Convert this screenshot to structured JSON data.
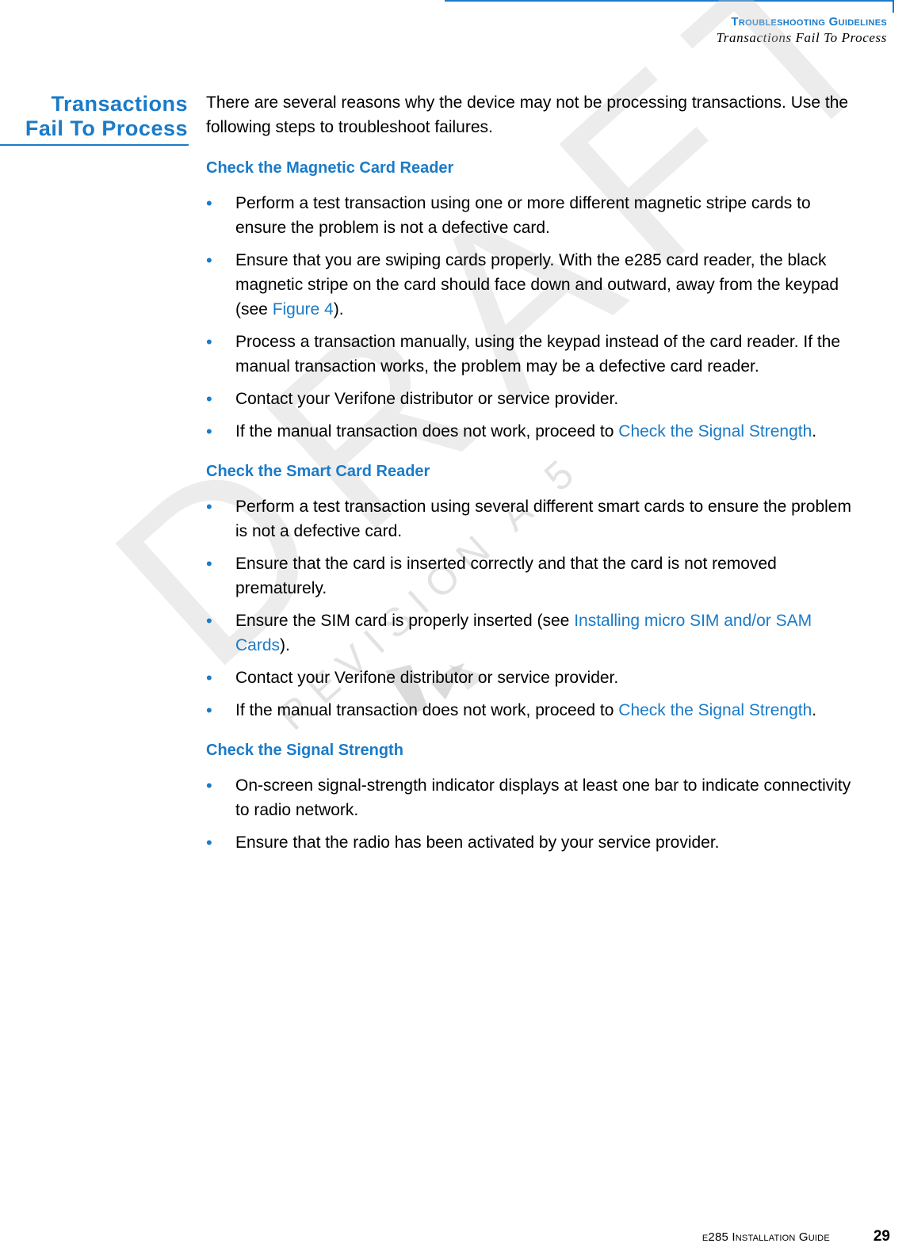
{
  "header": {
    "section": "Troubleshooting Guidelines",
    "topic": "Transactions Fail To Process"
  },
  "side_title": {
    "line1": "Transactions",
    "line2": "Fail To Process"
  },
  "intro": "There are several reasons why the device may not be processing transactions. Use the following steps to troubleshoot failures.",
  "sections": [
    {
      "heading": "Check the Magnetic Card Reader",
      "items": [
        {
          "text": "Perform a test transaction using one or more different magnetic stripe cards to ensure the problem is not a defective card."
        },
        {
          "text": "Ensure that you are swiping cards properly. With the e285 card reader, the black magnetic stripe on the card should face down and outward, away from the keypad (see ",
          "link": "Figure 4",
          "after": ")."
        },
        {
          "text": "Process a transaction manually, using the keypad instead of the card reader. If the manual transaction works, the problem may be a defective card reader."
        },
        {
          "text": "Contact your Verifone distributor or service provider."
        },
        {
          "text": "If the manual transaction does not work, proceed to ",
          "link": "Check the Signal Strength",
          "after": "."
        }
      ]
    },
    {
      "heading": "Check the Smart Card Reader",
      "items": [
        {
          "text": "Perform a test transaction using several different smart cards to ensure the problem is not a defective card."
        },
        {
          "text": "Ensure that the card is inserted correctly and that the card is not removed prematurely."
        },
        {
          "text": "Ensure the SIM card is properly inserted (see ",
          "link": "Installing micro SIM and/or SAM Cards",
          "after": ")."
        },
        {
          "text": "Contact your Verifone distributor or service provider."
        },
        {
          "text": "If the manual transaction does not work, proceed to ",
          "link": "Check the Signal Strength",
          "after": "."
        }
      ]
    },
    {
      "heading": "Check the Signal Strength",
      "items": [
        {
          "text": "On-screen signal-strength indicator displays at least one bar to indicate connectivity to radio network."
        },
        {
          "text": "Ensure that the radio has been activated by your service provider."
        }
      ]
    }
  ],
  "bullet_glyph": "•",
  "watermark": {
    "main": "DRAFT",
    "sub": "REVISION A.5",
    "logo_icon": "verifone-logo-icon"
  },
  "footer": {
    "guide": "e285 Installation Guide",
    "page": "29"
  },
  "colors": {
    "accent": "#1a7bc8",
    "text": "#000000",
    "watermark": "#c8c8c8"
  }
}
